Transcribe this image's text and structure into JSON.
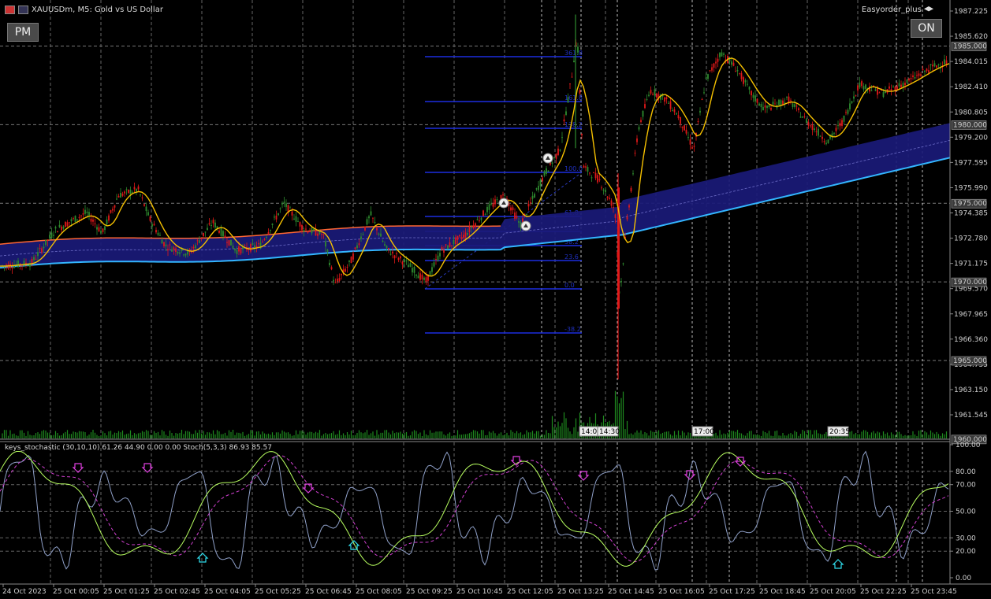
{
  "window": {
    "symbol_title": "XAUUSDm, M5:  Gold vs US Dollar",
    "expert_name": "Easyorder_plus",
    "pm_button": "PM",
    "on_button": "ON"
  },
  "price_axis": {
    "labels": [
      "1987.225",
      "1985.620",
      "1984.015",
      "1982.410",
      "1980.805",
      "1979.200",
      "1977.595",
      "1975.990",
      "1974.385",
      "1972.780",
      "1971.175",
      "1969.570",
      "1967.965",
      "1966.360",
      "1964.755",
      "1963.150",
      "1961.545"
    ],
    "level_boxes": [
      "1985.000",
      "1980.000",
      "1975.000",
      "1970.000",
      "1965.000",
      "1960.000"
    ]
  },
  "fibo_labels": [
    "361.8",
    "161.8",
    "138.2",
    "100.0",
    "61.8",
    "50.0",
    "38.2",
    "23.6",
    "0.0",
    "-38.2"
  ],
  "vline_time_labels": [
    "14:00",
    "14:30",
    "17:00",
    "20:35"
  ],
  "indicator": {
    "label": "keys_stochastic (30,10,10) 61.26 44.90 0.00 0.00  Stoch(5,3,3) 86.93 85.57",
    "axis_labels": [
      "100.00",
      "80.00",
      "70.00",
      "50.00",
      "30.00",
      "20.00",
      "0.00"
    ]
  },
  "time_axis": [
    "24 Oct 2023",
    "25 Oct 00:05",
    "25 Oct 01:25",
    "25 Oct 02:45",
    "25 Oct 04:05",
    "25 Oct 05:25",
    "25 Oct 06:45",
    "25 Oct 08:05",
    "25 Oct 09:25",
    "25 Oct 10:45",
    "25 Oct 12:05",
    "25 Oct 13:25",
    "25 Oct 14:45",
    "25 Oct 16:05",
    "25 Oct 17:25",
    "25 Oct 18:45",
    "25 Oct 20:05",
    "25 Oct 22:25",
    "25 Oct 23:45"
  ],
  "colors": {
    "bull": "#2e8b2e",
    "bear": "#e01818",
    "band_fill": "#1a1a78",
    "band_lower": "#33b5ff",
    "band_upper": "#ff6633",
    "ma": "#f5c000",
    "fibo": "#1c2ee0",
    "stoch_main": "#8fa0c8",
    "stoch_k": "#b8ff60",
    "stoch_d": "#d040d0"
  }
}
